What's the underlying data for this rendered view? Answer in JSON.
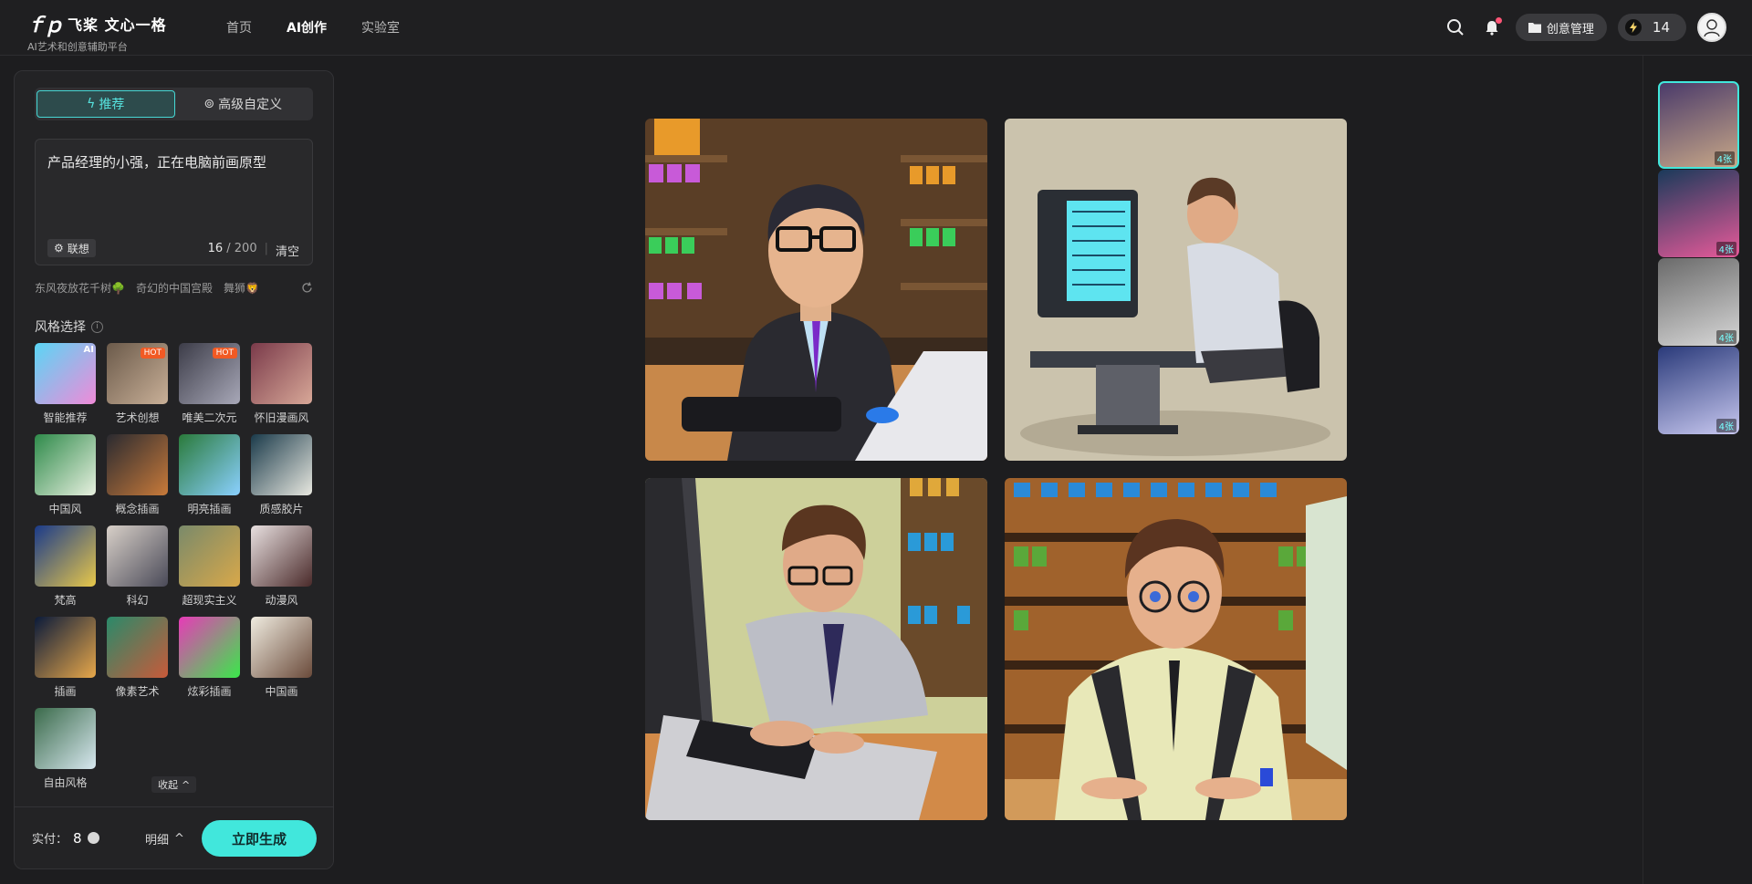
{
  "app": {
    "logo_mark": "Ⓟ",
    "logo_title": "飞桨 文心一格",
    "logo_subtitle": "AI艺术和创意辅助平台"
  },
  "nav": {
    "items": [
      {
        "label": "首页",
        "active": false
      },
      {
        "label": "AI创作",
        "active": true
      },
      {
        "label": "实验室",
        "active": false
      }
    ]
  },
  "header": {
    "creative_manage_label": "创意管理",
    "credits": "14"
  },
  "left_panel": {
    "tabs": [
      {
        "label": "推荐",
        "icon": "lightning-icon",
        "active": true
      },
      {
        "label": "高级自定义",
        "icon": "settings-icon",
        "active": false
      }
    ],
    "prompt": {
      "value": "产品经理的小强，正在电脑前画原型",
      "assoc_label": "联想",
      "count_current": "16",
      "count_max": "/ 200",
      "clear_label": "清空"
    },
    "suggestions": [
      "东风夜放花千树🌳",
      "奇幻的中国宫殿",
      "舞狮🦁"
    ],
    "style_section_title": "风格选择",
    "styles": [
      {
        "label": "智能推荐",
        "badge": "AI",
        "colors": [
          "#5ad6f5",
          "#f08ad8"
        ]
      },
      {
        "label": "艺术创想",
        "badge": "HOT",
        "colors": [
          "#6b5a4a",
          "#c9b098"
        ]
      },
      {
        "label": "唯美二次元",
        "badge": "HOT",
        "colors": [
          "#3c3c48",
          "#a8a8b8"
        ]
      },
      {
        "label": "怀旧漫画风",
        "badge": "",
        "colors": [
          "#7a3a4a",
          "#d8a898"
        ]
      },
      {
        "label": "中国风",
        "badge": "",
        "colors": [
          "#2e8a4a",
          "#e8f0e0"
        ]
      },
      {
        "label": "概念插画",
        "badge": "",
        "colors": [
          "#2a2a30",
          "#c87a3a"
        ]
      },
      {
        "label": "明亮插画",
        "badge": "",
        "colors": [
          "#2a7a3a",
          "#8ad0ff"
        ]
      },
      {
        "label": "质感胶片",
        "badge": "",
        "colors": [
          "#1a3a4a",
          "#e8e8e0"
        ]
      },
      {
        "label": "梵高",
        "badge": "",
        "colors": [
          "#1a3a8a",
          "#e8c84a"
        ]
      },
      {
        "label": "科幻",
        "badge": "",
        "colors": [
          "#d8d0c8",
          "#4a4a58"
        ]
      },
      {
        "label": "超现实主义",
        "badge": "",
        "colors": [
          "#7a8a6a",
          "#d8a84a"
        ]
      },
      {
        "label": "动漫风",
        "badge": "",
        "colors": [
          "#e8e0e0",
          "#4a2a2a"
        ]
      },
      {
        "label": "插画",
        "badge": "",
        "colors": [
          "#0a1a3a",
          "#e8a84a"
        ]
      },
      {
        "label": "像素艺术",
        "badge": "",
        "colors": [
          "#2a8a6a",
          "#c85a3a"
        ]
      },
      {
        "label": "炫彩插画",
        "badge": "",
        "colors": [
          "#e83ab8",
          "#3ae84a"
        ]
      },
      {
        "label": "中国画",
        "badge": "",
        "colors": [
          "#f0ece0",
          "#6a4a3a"
        ]
      },
      {
        "label": "自由风格",
        "badge": "",
        "colors": [
          "#3a6a4a",
          "#d8e8f0"
        ]
      }
    ],
    "collapse_label": "收起",
    "pay_label": "实付：",
    "pay_amount": "8",
    "detail_label": "明细",
    "generate_label": "立即生成"
  },
  "images": [
    {
      "alt": "戴眼镜的男子坐在电脑前",
      "bg": "#6a4a2a"
    },
    {
      "alt": "男子在电脑前工作",
      "bg": "#c8bfa8"
    },
    {
      "alt": "男子在键盘上打字",
      "bg": "#c8cc98"
    },
    {
      "alt": "男子坐在货架前",
      "bg": "#8a5a2a"
    }
  ],
  "history": [
    {
      "count": "4张",
      "active": true,
      "colors": [
        "#4a3a6a",
        "#c8a888"
      ]
    },
    {
      "count": "4张",
      "active": false,
      "colors": [
        "#1a3a5a",
        "#e85a9a"
      ]
    },
    {
      "count": "4张",
      "active": false,
      "colors": [
        "#6a6a6a",
        "#d8d8d8"
      ]
    },
    {
      "count": "4张",
      "active": false,
      "colors": [
        "#2a3a7a",
        "#c8c8f0"
      ]
    }
  ]
}
